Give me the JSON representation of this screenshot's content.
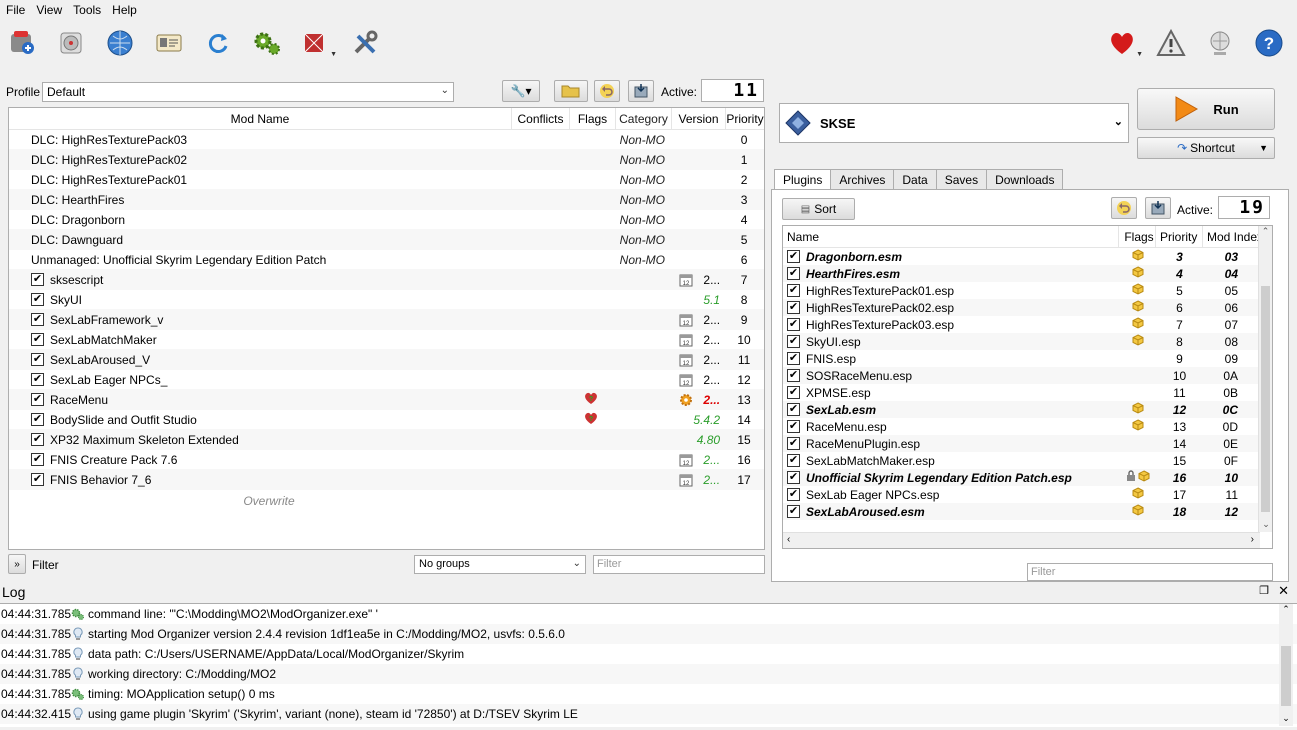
{
  "menu": [
    "File",
    "View",
    "Tools",
    "Help"
  ],
  "toolbar": {
    "left_icons": [
      "instance-manager-icon",
      "nexus-disk-icon",
      "nexus-globe-icon",
      "profiles-icon",
      "refresh-icon",
      "executables-gears-icon",
      "tools-puzzle-icon",
      "settings-tools-icon"
    ],
    "right_icons": [
      "endorse-heart-icon",
      "problems-warning-icon",
      "update-globe-icon",
      "help-icon"
    ]
  },
  "profile": {
    "label": "Profile",
    "value": "Default",
    "active_label": "Active:",
    "active_value": "11"
  },
  "modlist": {
    "headers": [
      "Mod Name",
      "Conflicts",
      "Flags",
      "Category",
      "Version",
      "Priority"
    ],
    "rows": [
      {
        "name": "DLC: HighResTexturePack03",
        "category": "Non-MO",
        "priority": "0",
        "checkbox": false
      },
      {
        "name": "DLC: HighResTexturePack02",
        "category": "Non-MO",
        "priority": "1",
        "checkbox": false
      },
      {
        "name": "DLC: HighResTexturePack01",
        "category": "Non-MO",
        "priority": "2",
        "checkbox": false
      },
      {
        "name": "DLC: HearthFires",
        "category": "Non-MO",
        "priority": "3",
        "checkbox": false
      },
      {
        "name": "DLC: Dragonborn",
        "category": "Non-MO",
        "priority": "4",
        "checkbox": false
      },
      {
        "name": "DLC: Dawnguard",
        "category": "Non-MO",
        "priority": "5",
        "checkbox": false
      },
      {
        "name": "Unmanaged: Unofficial Skyrim Legendary Edition Patch",
        "category": "Non-MO",
        "priority": "6",
        "checkbox": false
      },
      {
        "name": "sksescript",
        "version": "2...",
        "version_style": "normal",
        "cal": true,
        "priority": "7",
        "checkbox": true
      },
      {
        "name": "SkyUI",
        "version": "5.1",
        "version_style": "green",
        "priority": "8",
        "checkbox": true
      },
      {
        "name": "SexLabFramework_v",
        "version": "2...",
        "version_style": "normal",
        "cal": true,
        "priority": "9",
        "checkbox": true
      },
      {
        "name": "SexLabMatchMaker",
        "version": "2...",
        "version_style": "normal",
        "cal": true,
        "priority": "10",
        "checkbox": true
      },
      {
        "name": "SexLabAroused_V",
        "version": "2...",
        "version_style": "normal",
        "cal": true,
        "priority": "11",
        "checkbox": true
      },
      {
        "name": "SexLab Eager NPCs_",
        "version": "2...",
        "version_style": "normal",
        "cal": true,
        "priority": "12",
        "checkbox": true
      },
      {
        "name": "RaceMenu",
        "flag": true,
        "version": "2...",
        "version_style": "red",
        "gear": true,
        "priority": "13",
        "checkbox": true
      },
      {
        "name": "BodySlide and Outfit Studio",
        "flag": true,
        "version": "5.4.2",
        "version_style": "green",
        "priority": "14",
        "checkbox": true
      },
      {
        "name": "XP32 Maximum Skeleton Extended",
        "version": "4.80",
        "version_style": "green",
        "priority": "15",
        "checkbox": true
      },
      {
        "name": "FNIS Creature Pack 7.6",
        "version": "2...",
        "version_style": "green",
        "cal": true,
        "priority": "16",
        "checkbox": true
      },
      {
        "name": "FNIS Behavior 7_6",
        "version": "2...",
        "version_style": "green",
        "cal": true,
        "priority": "17",
        "checkbox": true
      }
    ],
    "overwrite": "Overwrite"
  },
  "filterbar": {
    "label": "Filter",
    "groups": "No groups",
    "placeholder": "Filter"
  },
  "executable": {
    "name": "SKSE",
    "run": "Run",
    "shortcut": "Shortcut"
  },
  "tabs": [
    "Plugins",
    "Archives",
    "Data",
    "Saves",
    "Downloads"
  ],
  "plugins": {
    "sort": "Sort",
    "active_label": "Active:",
    "active_value": "19",
    "headers": [
      "Name",
      "Flags",
      "Priority",
      "Mod Index"
    ],
    "rows": [
      {
        "name": "Dragonborn.esm",
        "priority": "3",
        "index": "03",
        "bold": true,
        "flag": true
      },
      {
        "name": "HearthFires.esm",
        "priority": "4",
        "index": "04",
        "bold": true,
        "flag": true
      },
      {
        "name": "HighResTexturePack01.esp",
        "priority": "5",
        "index": "05",
        "flag": true
      },
      {
        "name": "HighResTexturePack02.esp",
        "priority": "6",
        "index": "06",
        "flag": true
      },
      {
        "name": "HighResTexturePack03.esp",
        "priority": "7",
        "index": "07",
        "flag": true
      },
      {
        "name": "SkyUI.esp",
        "priority": "8",
        "index": "08",
        "flag": true
      },
      {
        "name": "FNIS.esp",
        "priority": "9",
        "index": "09"
      },
      {
        "name": "SOSRaceMenu.esp",
        "priority": "10",
        "index": "0A"
      },
      {
        "name": "XPMSE.esp",
        "priority": "11",
        "index": "0B"
      },
      {
        "name": "SexLab.esm",
        "priority": "12",
        "index": "0C",
        "bold": true,
        "flag": true
      },
      {
        "name": "RaceMenu.esp",
        "priority": "13",
        "index": "0D",
        "flag": true
      },
      {
        "name": "RaceMenuPlugin.esp",
        "priority": "14",
        "index": "0E"
      },
      {
        "name": "SexLabMatchMaker.esp",
        "priority": "15",
        "index": "0F"
      },
      {
        "name": "Unofficial Skyrim Legendary Edition Patch.esp",
        "priority": "16",
        "index": "10",
        "bold": true,
        "flag": true,
        "lock": true
      },
      {
        "name": "SexLab Eager NPCs.esp",
        "priority": "17",
        "index": "11",
        "flag": true
      },
      {
        "name": "SexLabAroused.esm",
        "priority": "18",
        "index": "12",
        "bold": true,
        "flag": true
      }
    ],
    "filter_placeholder": "Filter"
  },
  "log": {
    "title": "Log",
    "entries": [
      {
        "time": "04:44:31.785",
        "icon": "debug",
        "text": "command line: '\"C:\\Modding\\MO2\\ModOrganizer.exe\" '"
      },
      {
        "time": "04:44:31.785",
        "icon": "info",
        "text": "starting Mod Organizer version 2.4.4 revision 1df1ea5e in C:/Modding/MO2, usvfs: 0.5.6.0"
      },
      {
        "time": "04:44:31.785",
        "icon": "info",
        "text": "data path: C:/Users/USERNAME/AppData/Local/ModOrganizer/Skyrim"
      },
      {
        "time": "04:44:31.785",
        "icon": "info",
        "text": "working directory: C:/Modding/MO2"
      },
      {
        "time": "04:44:31.785",
        "icon": "debug",
        "text": "timing: MOApplication setup() 0 ms"
      },
      {
        "time": "04:44:32.415",
        "icon": "info",
        "text": "using game plugin 'Skyrim' ('Skyrim', variant (none), steam id '72850') at D:/TSEV Skyrim LE"
      }
    ]
  }
}
